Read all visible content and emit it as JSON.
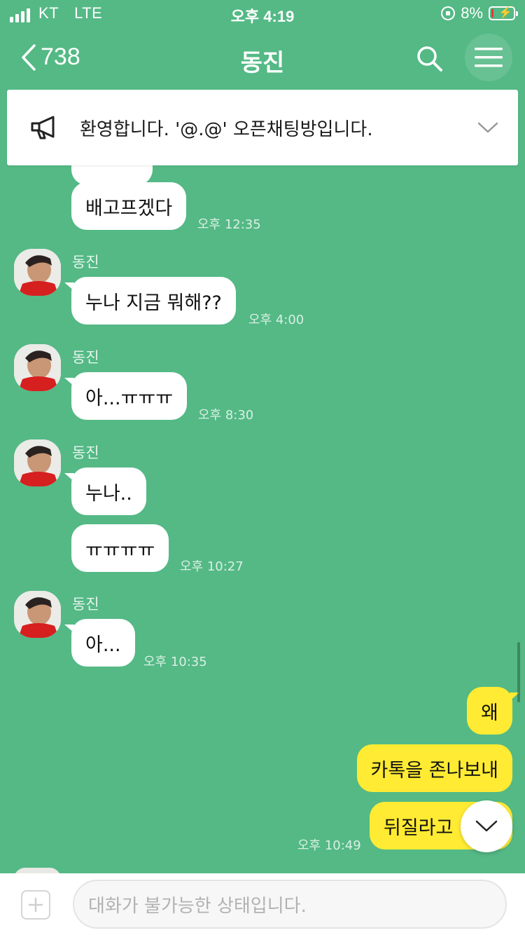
{
  "status_bar": {
    "carrier": "KT",
    "network": "LTE",
    "time": "오후 4:19",
    "battery_percent": "8%",
    "battery_level": 0.08
  },
  "nav": {
    "back_count": "738",
    "title": "동진",
    "icons": [
      "chevron-left-icon",
      "search-icon",
      "menu-icon"
    ]
  },
  "notice": {
    "text": "환영합니다. '@.@' 오픈채팅방입니다."
  },
  "messages": {
    "m1": {
      "text": "배고프겠다",
      "time": "오후 12:35"
    },
    "g2": {
      "sender": "동진",
      "text": "누나 지금 뭐해??",
      "time": "오후 4:00"
    },
    "g3": {
      "sender": "동진",
      "text": "아...ㅠㅠㅠ",
      "time": "오후 8:30"
    },
    "g4": {
      "sender": "동진",
      "text1": "누나..",
      "text2": "ㅠㅠㅠㅠ",
      "time": "오후 10:27"
    },
    "g5": {
      "sender": "동진",
      "text": "아...",
      "time": "오후 10:35"
    },
    "me": {
      "text1": "왜",
      "text2": "카톡을 존나보내",
      "text3": "뒤질라고",
      "time": "오후 10:49"
    }
  },
  "input": {
    "placeholder": "대화가 불가능한 상태입니다."
  },
  "colors": {
    "chat_background": "#54b985",
    "my_bubble": "#ffeb33",
    "their_bubble": "#ffffff"
  }
}
